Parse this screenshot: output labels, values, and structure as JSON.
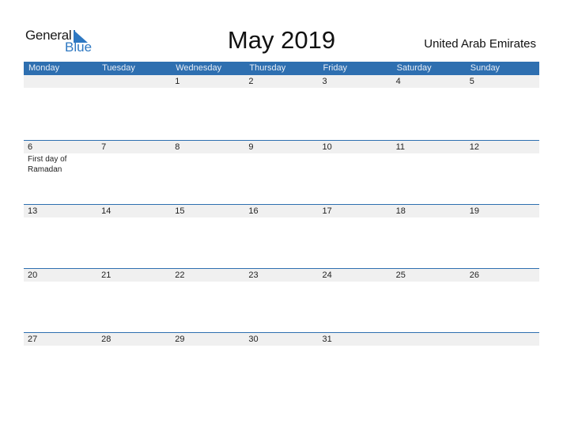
{
  "logo": {
    "line1": "General",
    "line2": "Blue",
    "accent": "#2e78c2"
  },
  "title": "May 2019",
  "country": "United Arab Emirates",
  "colors": {
    "header_bg": "#2e6fb0",
    "day_row_bg": "#f0f0f0"
  },
  "days": [
    "Monday",
    "Tuesday",
    "Wednesday",
    "Thursday",
    "Friday",
    "Saturday",
    "Sunday"
  ],
  "weeks": [
    {
      "nums": [
        "",
        "",
        "1",
        "2",
        "3",
        "4",
        "5"
      ],
      "events": [
        "",
        "",
        "",
        "",
        "",
        "",
        ""
      ]
    },
    {
      "nums": [
        "6",
        "7",
        "8",
        "9",
        "10",
        "11",
        "12"
      ],
      "events": [
        "First day of Ramadan",
        "",
        "",
        "",
        "",
        "",
        ""
      ]
    },
    {
      "nums": [
        "13",
        "14",
        "15",
        "16",
        "17",
        "18",
        "19"
      ],
      "events": [
        "",
        "",
        "",
        "",
        "",
        "",
        ""
      ]
    },
    {
      "nums": [
        "20",
        "21",
        "22",
        "23",
        "24",
        "25",
        "26"
      ],
      "events": [
        "",
        "",
        "",
        "",
        "",
        "",
        ""
      ]
    },
    {
      "nums": [
        "27",
        "28",
        "29",
        "30",
        "31",
        "",
        ""
      ],
      "events": [
        "",
        "",
        "",
        "",
        "",
        "",
        ""
      ]
    }
  ]
}
